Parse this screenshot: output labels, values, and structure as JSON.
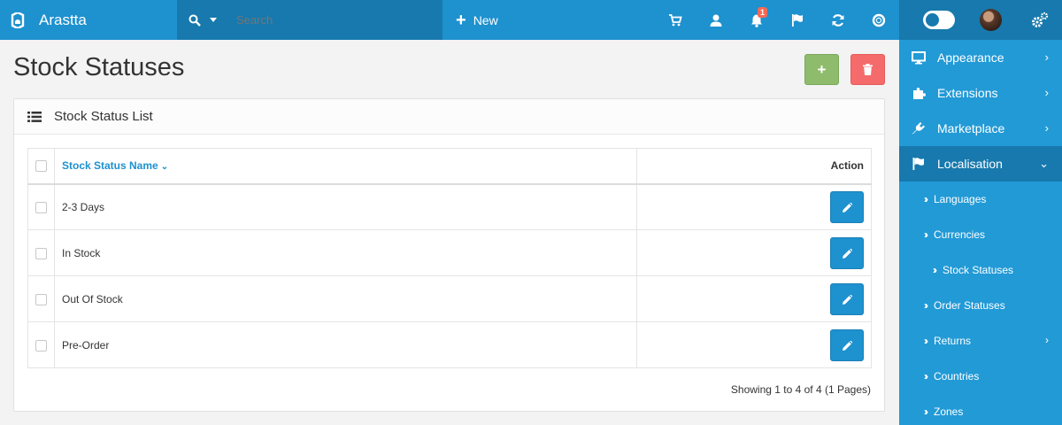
{
  "header": {
    "brand": "Arastta",
    "search_placeholder": "Search",
    "new_label": "New",
    "notification_count": "1"
  },
  "page": {
    "title": "Stock Statuses"
  },
  "panel": {
    "title": "Stock Status List",
    "columns": {
      "name": "Stock Status Name",
      "action": "Action"
    },
    "rows": [
      {
        "name": "2-3 Days"
      },
      {
        "name": "In Stock"
      },
      {
        "name": "Out Of Stock"
      },
      {
        "name": "Pre-Order"
      }
    ],
    "showing": "Showing 1 to 4 of 4 (1 Pages)"
  },
  "sidebar": {
    "items": [
      {
        "label": "Appearance"
      },
      {
        "label": "Extensions"
      },
      {
        "label": "Marketplace"
      },
      {
        "label": "Localisation"
      }
    ],
    "subitems": [
      {
        "label": "Languages"
      },
      {
        "label": "Currencies"
      },
      {
        "label": "Stock Statuses"
      },
      {
        "label": "Order Statuses"
      },
      {
        "label": "Returns"
      },
      {
        "label": "Countries"
      },
      {
        "label": "Zones"
      }
    ]
  },
  "colors": {
    "primary": "#1e91cf",
    "primary_dark": "#1779ad",
    "success": "#8fbb6c",
    "danger": "#f56b6b"
  }
}
